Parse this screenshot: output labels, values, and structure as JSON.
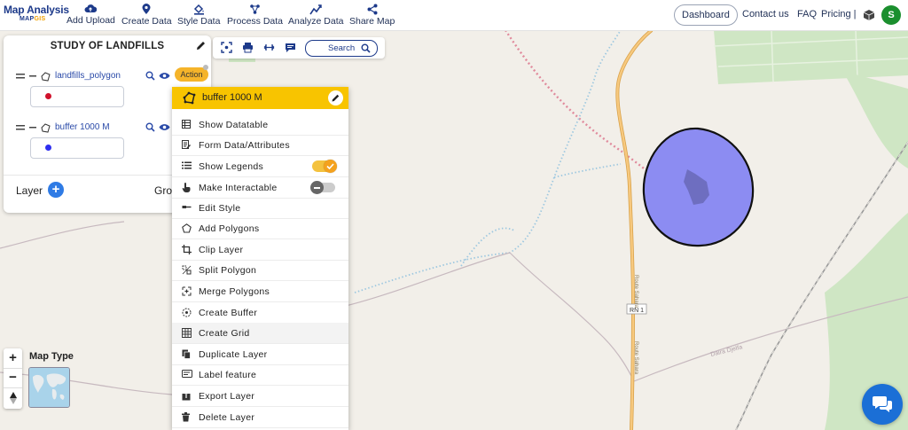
{
  "app": {
    "logo_title": "Map Analysis",
    "logo_sub_a": "MAP",
    "logo_sub_b": "GIS"
  },
  "nav": {
    "items": [
      {
        "label": "Add Upload",
        "icon": "cloud-upload-icon"
      },
      {
        "label": "Create Data",
        "icon": "map-pin-icon"
      },
      {
        "label": "Style Data",
        "icon": "paint-bucket-icon"
      },
      {
        "label": "Process Data",
        "icon": "process-icon"
      },
      {
        "label": "Analyze Data",
        "icon": "analyze-icon"
      },
      {
        "label": "Share Map",
        "icon": "share-icon"
      }
    ],
    "dashboard": "Dashboard",
    "contact": "Contact us",
    "faq": "FAQ",
    "pricing": "Pricing |",
    "avatar_initial": "S"
  },
  "panel": {
    "title": "STUDY OF LANDFILLS",
    "layers": [
      {
        "name": "landfills_polygon",
        "dot_color": "#d0112b"
      },
      {
        "name": "buffer 1000 M",
        "dot_color": "#2f2ff0"
      }
    ],
    "action_label": "Action",
    "layer_label": "Layer",
    "group_label": "Grou"
  },
  "toolbar": {
    "search_label": "Search"
  },
  "context_menu": {
    "header": "buffer 1000 M",
    "items": [
      {
        "label": "Show Datatable",
        "icon": "table-icon"
      },
      {
        "label": "Form Data/Attributes",
        "icon": "form-icon"
      },
      {
        "label": "Show Legends",
        "icon": "list-icon",
        "toggle": "on"
      },
      {
        "label": "Make Interactable",
        "icon": "hand-pointer-icon",
        "toggle": "off"
      },
      {
        "label": "Edit Style",
        "icon": "brush-icon"
      },
      {
        "label": "Add Polygons",
        "icon": "pentagon-icon"
      },
      {
        "label": "Clip Layer",
        "icon": "crop-icon"
      },
      {
        "label": "Split Polygon",
        "icon": "split-icon"
      },
      {
        "label": "Merge Polygons",
        "icon": "merge-icon"
      },
      {
        "label": "Create Buffer",
        "icon": "buffer-icon"
      },
      {
        "label": "Create Grid",
        "icon": "grid-icon"
      },
      {
        "label": "Duplicate Layer",
        "icon": "copy-icon"
      },
      {
        "label": "Label feature",
        "icon": "label-icon"
      },
      {
        "label": "Export Layer",
        "icon": "export-icon"
      },
      {
        "label": "Delete Layer",
        "icon": "trash-icon"
      }
    ]
  },
  "map_controls": {
    "zoom_in": "+",
    "zoom_out": "−",
    "map_type_label": "Map Type"
  },
  "map_labels": {
    "road": "RN 1",
    "road_vertical": "Route Sahara",
    "road_side": "Daira Djelfa"
  },
  "colors": {
    "brand": "#1d3a8a",
    "accent_yellow": "#f8c400",
    "buffer_fill": "#8c8cf2",
    "avatar": "#1b8f2e"
  }
}
